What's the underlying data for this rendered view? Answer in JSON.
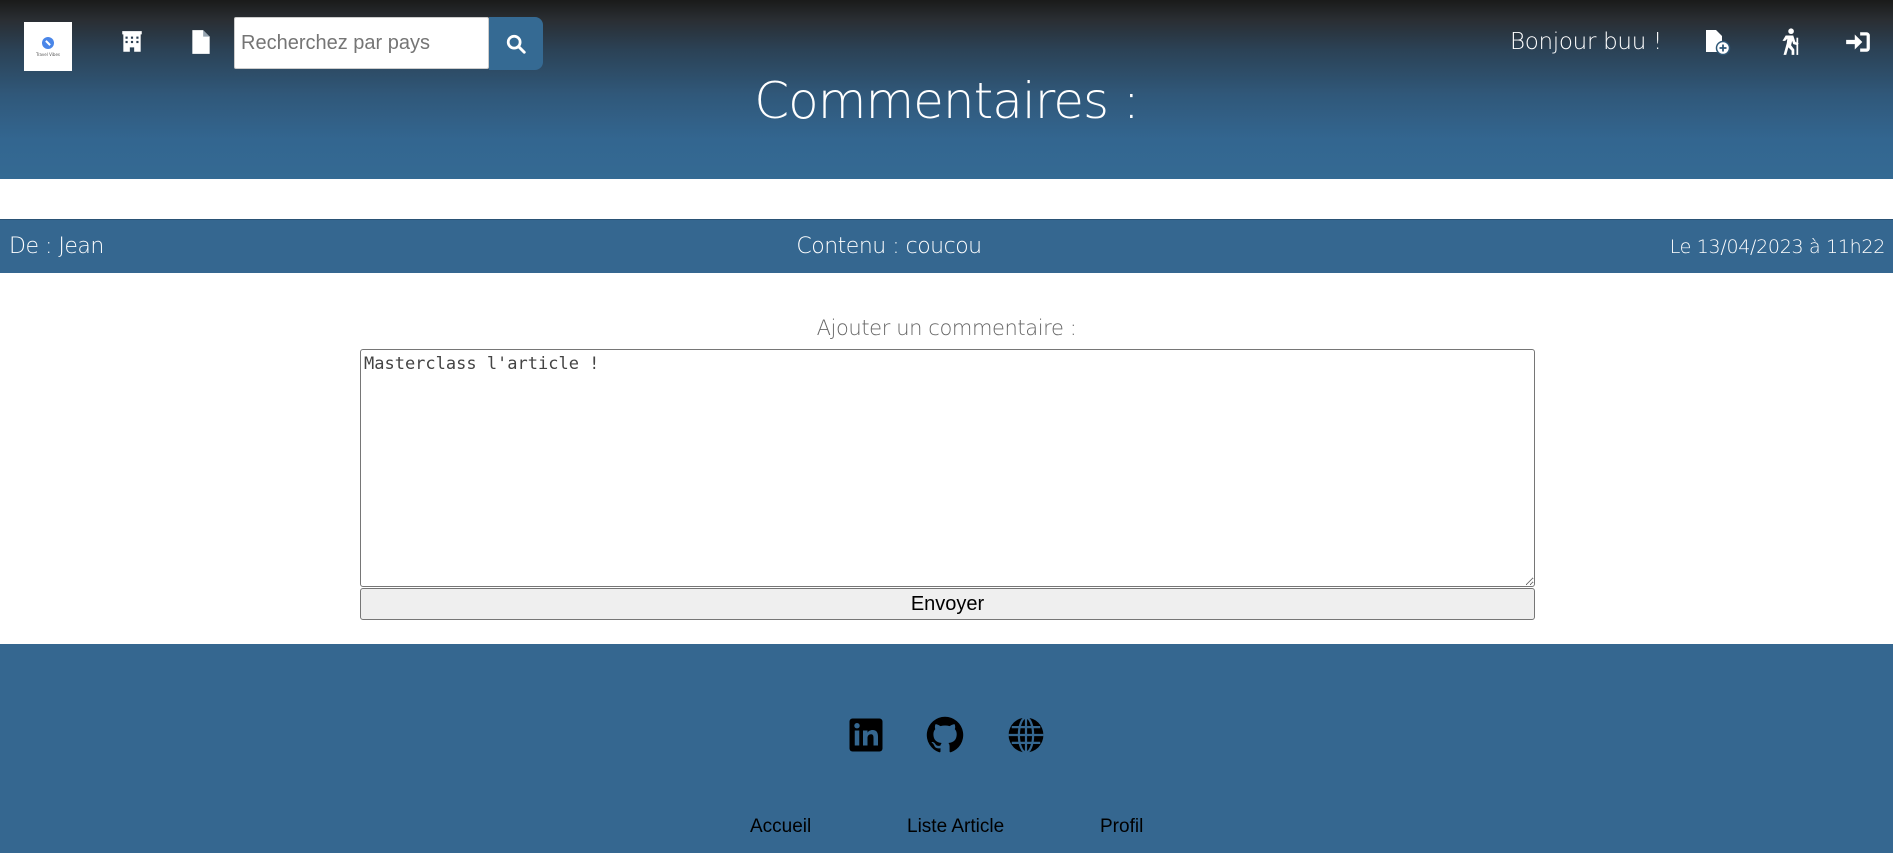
{
  "header": {
    "logo_text": "Travel Vibes",
    "search": {
      "placeholder": "Recherchez par pays",
      "value": ""
    },
    "greeting": "Bonjour buu !",
    "title": "Commentaires :",
    "icons": {
      "hotel": "hotel-icon",
      "document": "file-icon",
      "search": "search-icon",
      "add_article": "file-add-icon",
      "hiking": "hiking-icon",
      "login": "login-icon"
    }
  },
  "comments": [
    {
      "author": "De : Jean",
      "content": "Contenu : coucou",
      "date": "Le 13/04/2023 à 11h22"
    }
  ],
  "form": {
    "label": "Ajouter un commentaire :",
    "textarea_value": "Masterclass l'article !",
    "submit_label": "Envoyer"
  },
  "footer": {
    "social_icons": [
      "linkedin-icon",
      "github-icon",
      "globe-icon"
    ],
    "links": [
      "Accueil",
      "Liste Article",
      "Profil"
    ]
  },
  "colors": {
    "primary": "#356790",
    "header_top": "#1a1a1a",
    "white": "#ffffff"
  }
}
